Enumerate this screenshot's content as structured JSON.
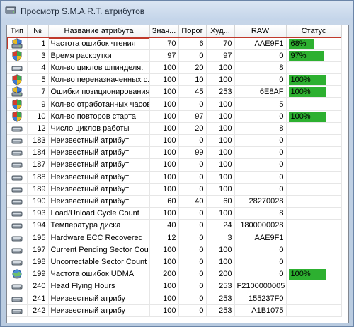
{
  "window": {
    "title": "Просмотр S.M.A.R.T. атрибутов"
  },
  "table": {
    "headers": [
      "Тип",
      "№",
      "Название атрибута",
      "Знач...",
      "Порог",
      "Худ...",
      "RAW",
      "Статус"
    ],
    "rows": [
      {
        "icon": "hdd-icon-warning",
        "num": "1",
        "name": "Частота ошибок чтения",
        "value": "70",
        "threshold": "6",
        "worst": "70",
        "raw": "AAE9F1",
        "status": "68%",
        "bar": 0.68
      },
      {
        "icon": "shield-icon",
        "num": "3",
        "name": "Время раскрутки",
        "value": "97",
        "threshold": "0",
        "worst": "97",
        "raw": "0",
        "status": "97%",
        "bar": 0.97
      },
      {
        "icon": "hdd-icon",
        "num": "4",
        "name": "Кол-во циклов шпинделя.",
        "value": "100",
        "threshold": "20",
        "worst": "100",
        "raw": "8",
        "status": "",
        "bar": 0
      },
      {
        "icon": "shield-icon",
        "num": "5",
        "name": "Кол-во переназначенных с...",
        "value": "100",
        "threshold": "10",
        "worst": "100",
        "raw": "0",
        "status": "100%",
        "bar": 1.0
      },
      {
        "icon": "hdd-icon-warning",
        "num": "7",
        "name": "Ошибки позиционирования",
        "value": "100",
        "threshold": "45",
        "worst": "253",
        "raw": "6E8AF",
        "status": "100%",
        "bar": 1.0
      },
      {
        "icon": "shield-icon",
        "num": "9",
        "name": "Кол-во отработанных часов",
        "value": "100",
        "threshold": "0",
        "worst": "100",
        "raw": "5",
        "status": "",
        "bar": 0
      },
      {
        "icon": "shield-icon",
        "num": "10",
        "name": "Кол-во повторов старта",
        "value": "100",
        "threshold": "97",
        "worst": "100",
        "raw": "0",
        "status": "100%",
        "bar": 1.0
      },
      {
        "icon": "hdd-icon",
        "num": "12",
        "name": "Число циклов работы",
        "value": "100",
        "threshold": "20",
        "worst": "100",
        "raw": "8",
        "status": "",
        "bar": 0
      },
      {
        "icon": "hdd-icon",
        "num": "183",
        "name": "Неизвестный атрибут",
        "value": "100",
        "threshold": "0",
        "worst": "100",
        "raw": "0",
        "status": "",
        "bar": 0
      },
      {
        "icon": "hdd-icon",
        "num": "184",
        "name": "Неизвестный атрибут",
        "value": "100",
        "threshold": "99",
        "worst": "100",
        "raw": "0",
        "status": "",
        "bar": 0
      },
      {
        "icon": "hdd-icon",
        "num": "187",
        "name": "Неизвестный атрибут",
        "value": "100",
        "threshold": "0",
        "worst": "100",
        "raw": "0",
        "status": "",
        "bar": 0
      },
      {
        "icon": "hdd-icon",
        "num": "188",
        "name": "Неизвестный атрибут",
        "value": "100",
        "threshold": "0",
        "worst": "100",
        "raw": "0",
        "status": "",
        "bar": 0
      },
      {
        "icon": "hdd-icon",
        "num": "189",
        "name": "Неизвестный атрибут",
        "value": "100",
        "threshold": "0",
        "worst": "100",
        "raw": "0",
        "status": "",
        "bar": 0
      },
      {
        "icon": "hdd-icon",
        "num": "190",
        "name": "Неизвестный атрибут",
        "value": "60",
        "threshold": "40",
        "worst": "60",
        "raw": "28270028",
        "status": "",
        "bar": 0
      },
      {
        "icon": "hdd-icon",
        "num": "193",
        "name": "Load/Unload Cycle Count",
        "value": "100",
        "threshold": "0",
        "worst": "100",
        "raw": "8",
        "status": "",
        "bar": 0
      },
      {
        "icon": "hdd-icon",
        "num": "194",
        "name": "Температура диска",
        "value": "40",
        "threshold": "0",
        "worst": "24",
        "raw": "1800000028",
        "status": "",
        "bar": 0
      },
      {
        "icon": "hdd-icon",
        "num": "195",
        "name": "Hardware ECC Recovered",
        "value": "12",
        "threshold": "0",
        "worst": "3",
        "raw": "AAE9F1",
        "status": "",
        "bar": 0
      },
      {
        "icon": "hdd-icon",
        "num": "197",
        "name": "Current Pending Sector Count",
        "value": "100",
        "threshold": "0",
        "worst": "100",
        "raw": "0",
        "status": "",
        "bar": 0
      },
      {
        "icon": "hdd-icon",
        "num": "198",
        "name": "Uncorrectable Sector Count",
        "value": "100",
        "threshold": "0",
        "worst": "100",
        "raw": "0",
        "status": "",
        "bar": 0
      },
      {
        "icon": "globe-icon",
        "num": "199",
        "name": "Частота ошибок UDMA",
        "value": "200",
        "threshold": "0",
        "worst": "200",
        "raw": "0",
        "status": "100%",
        "bar": 1.0
      },
      {
        "icon": "hdd-icon",
        "num": "240",
        "name": "Head Flying Hours",
        "value": "100",
        "threshold": "0",
        "worst": "253",
        "raw": "F2100000005",
        "status": "",
        "bar": 0
      },
      {
        "icon": "hdd-icon",
        "num": "241",
        "name": "Неизвестный атрибут",
        "value": "100",
        "threshold": "0",
        "worst": "253",
        "raw": "155237F0",
        "status": "",
        "bar": 0
      },
      {
        "icon": "hdd-icon",
        "num": "242",
        "name": "Неизвестный атрибут",
        "value": "100",
        "threshold": "0",
        "worst": "253",
        "raw": "A1B1075",
        "status": "",
        "bar": 0
      }
    ]
  },
  "colors": {
    "status_bar": "#2db030",
    "selection": "#c0392b"
  }
}
